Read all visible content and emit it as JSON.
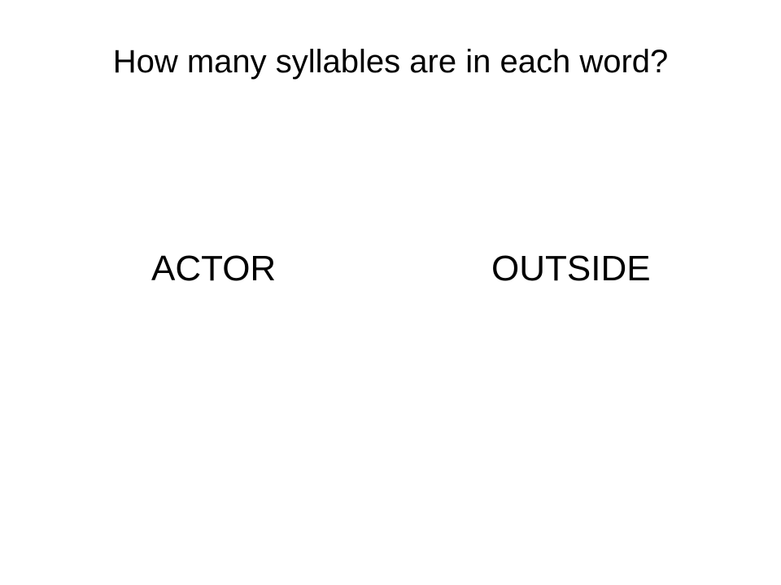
{
  "slide": {
    "title": "How many syllables are in each word?",
    "words": [
      "ACTOR",
      "OUTSIDE"
    ]
  }
}
